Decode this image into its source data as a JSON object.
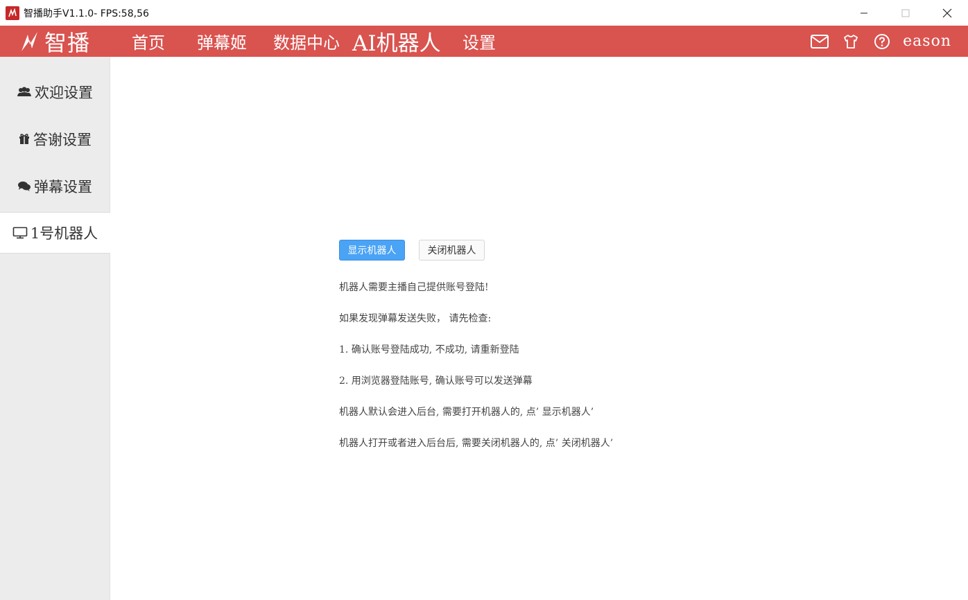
{
  "window": {
    "title": "智播助手V1.1.0- FPS:58,56"
  },
  "header": {
    "brand": "智播",
    "nav": [
      "首页",
      "弹幕姬",
      "数据中心",
      "AI机器人",
      "设置"
    ],
    "active_nav": "AI机器人",
    "username": "eason",
    "icons": [
      "mail-icon",
      "shirt-icon",
      "help-icon"
    ],
    "color": "#d9534f"
  },
  "sidebar": {
    "items": [
      {
        "label": "欢迎设置",
        "icon": "users-icon"
      },
      {
        "label": "答谢设置",
        "icon": "gift-icon"
      },
      {
        "label": "弹幕设置",
        "icon": "comments-icon"
      },
      {
        "label": "1号机器人",
        "icon": "monitor-icon"
      }
    ],
    "active": "1号机器人"
  },
  "main": {
    "show_button": "显示机器人",
    "close_button": "关闭机器人",
    "lines": [
      "机器人需要主播自己提供账号登陆!",
      "如果发现弹幕发送失败， 请先检查:",
      "1.  确认账号登陆成功, 不成功, 请重新登陆",
      "2.  用浏览器登陆账号, 确认账号可以发送弹幕",
      "机器人默认会进入后台, 需要打开机器人的, 点’ 显示机器人’",
      "机器人打开或者进入后台后, 需要关闭机器人的, 点’ 关闭机器人’"
    ],
    "primary_color": "#4aa3f5"
  }
}
